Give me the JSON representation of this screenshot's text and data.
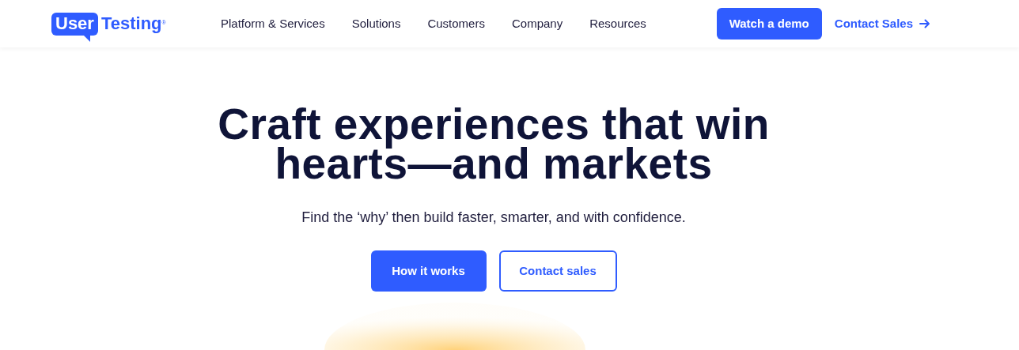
{
  "logo": {
    "badge": "User",
    "word": "Testing",
    "mark": "®"
  },
  "nav": [
    "Platform & Services",
    "Solutions",
    "Customers",
    "Company",
    "Resources"
  ],
  "header_actions": {
    "primary": "Watch a demo",
    "link": "Contact Sales"
  },
  "hero": {
    "title_lines": [
      "Craft experiences that win",
      "hearts—and markets"
    ],
    "subtitle": "Find the ‘why’ then build faster, smarter, and with confidence.",
    "buttons": [
      {
        "label": "How it works",
        "kind": "primary"
      },
      {
        "label": "Contact sales",
        "kind": "outline"
      }
    ]
  }
}
